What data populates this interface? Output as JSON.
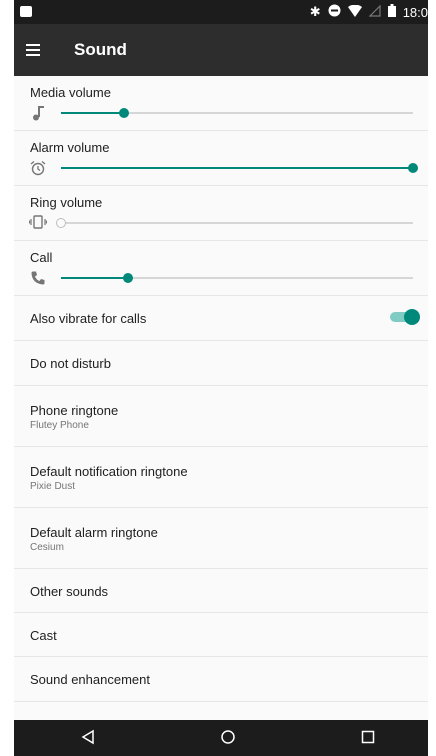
{
  "status_bar": {
    "time": "18:0",
    "icons": [
      "image-icon",
      "bluetooth-icon",
      "do-not-disturb-icon",
      "wifi-icon",
      "no-signal-icon",
      "battery-icon"
    ]
  },
  "toolbar": {
    "title": "Sound",
    "menu_icon": "hamburger-menu-icon"
  },
  "volumes": [
    {
      "label": "Media volume",
      "icon": "music-note-icon",
      "level": 0.18
    },
    {
      "label": "Alarm volume",
      "icon": "alarm-clock-icon",
      "level": 1.0
    },
    {
      "label": "Ring volume",
      "icon": "vibrate-icon",
      "level": 0.0
    },
    {
      "label": "Call",
      "icon": "phone-icon",
      "level": 0.19
    }
  ],
  "settings": {
    "vibrate_label": "Also vibrate for calls",
    "vibrate_on": true,
    "dnd_label": "Do not disturb",
    "phone_ringtone_title": "Phone ringtone",
    "phone_ringtone_value": "Flutey Phone",
    "notification_title": "Default notification ringtone",
    "notification_value": "Pixie Dust",
    "alarm_title": "Default alarm ringtone",
    "alarm_value": "Cesium",
    "other_sounds": "Other sounds",
    "cast": "Cast",
    "sound_enhancement": "Sound enhancement"
  },
  "colors": {
    "accent": "#00897b",
    "toolbar": "#2d2d2d",
    "status_bar": "#1c1c1c",
    "background": "#fafafa"
  },
  "nav_bar": {
    "icons": [
      "back-icon",
      "home-icon",
      "recents-icon"
    ]
  }
}
